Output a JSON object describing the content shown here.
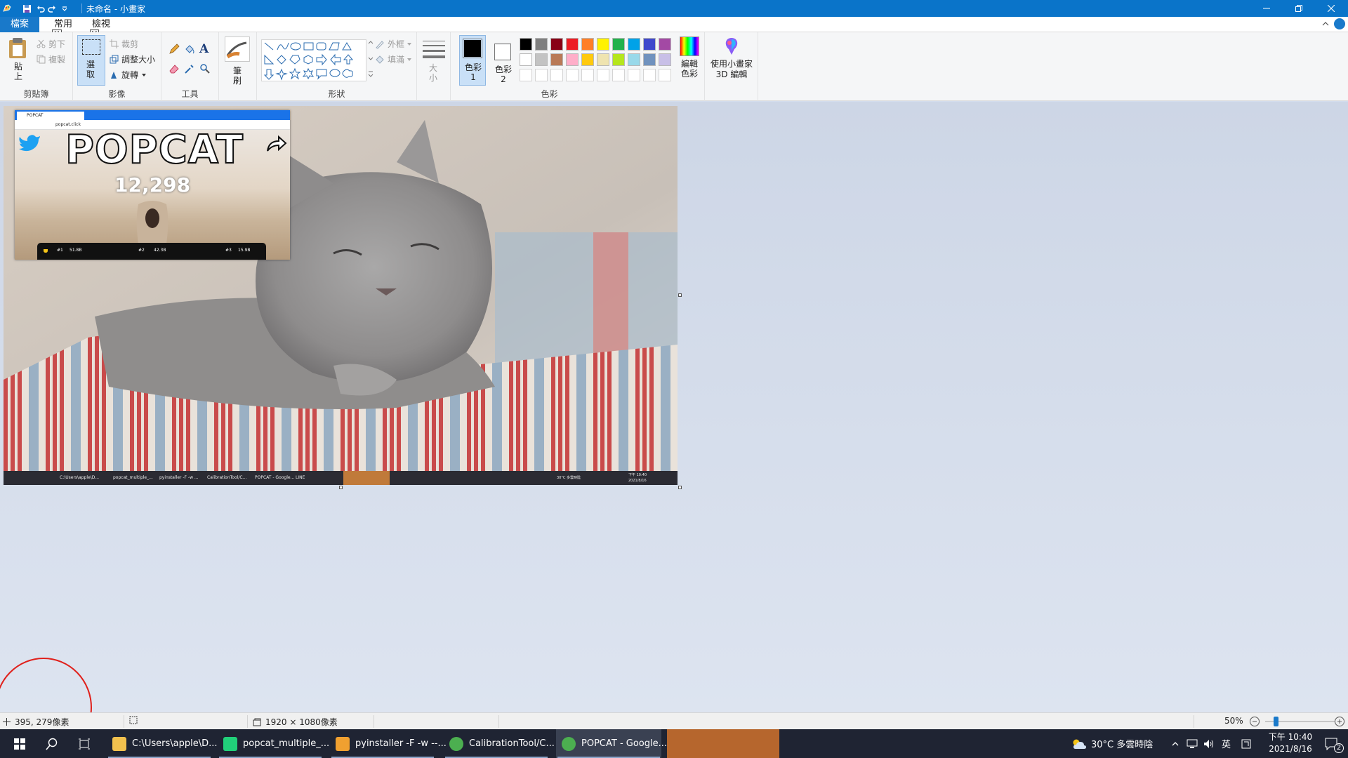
{
  "window": {
    "title": "未命名 - 小畫家",
    "controls": [
      "minimize",
      "restore",
      "close"
    ]
  },
  "quick_access": [
    "paint-app-icon",
    "save-icon",
    "undo-icon",
    "redo-icon",
    "customize-quick-access-icon"
  ],
  "tabs": {
    "file": "檔案",
    "home": "常用",
    "view": "檢視",
    "keytip_home": "H",
    "keytip_view": "V"
  },
  "ribbon": {
    "clipboard": {
      "label": "剪貼簿",
      "paste": "貼上",
      "cut": "剪下",
      "copy": "複製"
    },
    "image": {
      "label": "影像",
      "select": "選取",
      "crop": "裁剪",
      "resize": "調整大小",
      "rotate": "旋轉"
    },
    "tools": {
      "label": "工具",
      "items": [
        "pencil-icon",
        "fill-icon",
        "text-icon",
        "eraser-icon",
        "color-picker-icon",
        "magnifier-icon"
      ]
    },
    "brushes": {
      "label": "筆刷"
    },
    "shapes": {
      "label": "形狀",
      "outline": "外框",
      "fill": "填滿"
    },
    "size": {
      "label": "大小"
    },
    "colors": {
      "label": "色彩",
      "color1": "色彩 1",
      "color2": "色彩 2",
      "edit_colors": "編輯色彩",
      "paint3d": "使用小畫家 3D 編輯",
      "color1_value": "#000000",
      "color2_value": "#ffffff",
      "palette_row1": [
        "#000000",
        "#7f7f7f",
        "#880015",
        "#ed1c24",
        "#ff7f27",
        "#fff200",
        "#22b14c",
        "#00a2e8",
        "#3f48cc",
        "#a349a4"
      ],
      "palette_row2": [
        "#ffffff",
        "#c3c3c3",
        "#b97a57",
        "#ffaec9",
        "#ffc90e",
        "#efe4b0",
        "#b5e61d",
        "#99d9ea",
        "#7092be",
        "#c8bfe7"
      ]
    }
  },
  "popcat": {
    "tab_title": "POPCAT",
    "url": "popcat.click",
    "heading": "POPCAT",
    "count": "12,298",
    "leaderboard": [
      "#1",
      "51.8B",
      "#2",
      "42.3B",
      "#3",
      "15.9B"
    ]
  },
  "inner_taskbar": {
    "items": [
      "C:\\Users\\apple\\D...",
      "popcat_multiple_...",
      "pyinstaller -F -w ...",
      "CalibrationTool/C...",
      "POPCAT - Google...",
      "LINE"
    ],
    "weather": "30°C 多雲時陰",
    "time": "下午 10:40",
    "date": "2021/8/16"
  },
  "statusbar": {
    "cursor_pos": "395, 279像素",
    "image_size": "1920 × 1080像素",
    "zoom": "50%",
    "zoom_level": 0.5
  },
  "taskbar": {
    "apps": [
      "C:\\Users\\apple\\D...",
      "popcat_multiple_...",
      "pyinstaller -F -w --...",
      "CalibrationTool/C...",
      "POPCAT - Google...",
      "LINE"
    ],
    "weather": "30°C  多雲時陰",
    "ime": "英",
    "time": "下午 10:40",
    "date": "2021/8/16",
    "notifications": "2"
  }
}
